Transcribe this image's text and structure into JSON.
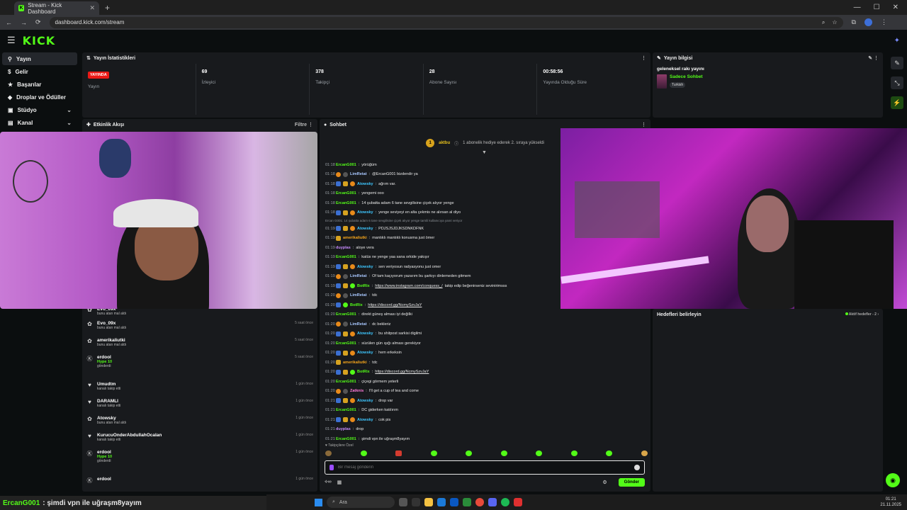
{
  "browser": {
    "tab_title": "Stream - Kick Dashboard",
    "url": "dashboard.kick.com/stream"
  },
  "header": {
    "logo": "KICK"
  },
  "sidebar": {
    "items": [
      {
        "label": "Yayın"
      },
      {
        "label": "Gelir"
      },
      {
        "label": "Başarılar"
      },
      {
        "label": "Droplar ve Ödüller"
      },
      {
        "label": "Stüdyo"
      },
      {
        "label": "Kanal"
      }
    ]
  },
  "stats": {
    "title": "Yayın İstatistikleri",
    "live_badge": "YAYINDA",
    "cells": [
      {
        "value": "",
        "label": "Yayın"
      },
      {
        "value": "69",
        "label": "İzleyici"
      },
      {
        "value": "378",
        "label": "Takipçi"
      },
      {
        "value": "28",
        "label": "Abone Sayısı"
      },
      {
        "value": "00:58:56",
        "label": "Yayında Olduğu Süre"
      }
    ]
  },
  "info": {
    "title": "Yayın bilgisi",
    "stream_title": "geleneksel rakı yayını",
    "category": "Sadece Sohbet",
    "language": "Turkish"
  },
  "activity": {
    "title": "Etkinlik Akışı",
    "filter": "Filtre",
    "items": [
      {
        "name": "Evo_09x",
        "sub": "bunu atan mal aldı",
        "time": "",
        "hype": ""
      },
      {
        "name": "Evo_09x",
        "sub": "bunu atan mal aldı",
        "time": "5 saat önce",
        "hype": ""
      },
      {
        "name": "amerikaliutki",
        "sub": "bunu atan mal aldı",
        "time": "5 saat önce",
        "hype": ""
      },
      {
        "name": "erdool",
        "sub": "gönderdi",
        "time": "5 saat önce",
        "hype": "Hype 10"
      },
      {
        "name": "Umudtm",
        "sub": "kanalı takip etti",
        "time": "1 gün önce",
        "hype": ""
      },
      {
        "name": "DARAMLI",
        "sub": "kanalı takip etti",
        "time": "1 gün önce",
        "hype": ""
      },
      {
        "name": "Atowsky",
        "sub": "bunu atan mal aldı",
        "time": "1 gün önce",
        "hype": ""
      },
      {
        "name": "KurucuOnderAbdullahOcalan",
        "sub": "kanalı takip etti",
        "time": "1 gün önce",
        "hype": ""
      },
      {
        "name": "erdool",
        "sub": "gönderdi",
        "time": "1 gün önce",
        "hype": "Hype 10"
      },
      {
        "name": "erdool",
        "sub": "",
        "time": "1 gün önce",
        "hype": ""
      }
    ]
  },
  "chat": {
    "title": "Sohbet",
    "pinned_user": "aktbu",
    "pinned_text": "1 abonelik hediye ederek 2. sıraya yükseldi",
    "follower_note": "Takipçilere Özel",
    "input_placeholder": "Bir mesaj gönderin",
    "send_label": "Gönder",
    "messages": [
      {
        "time": "01:18",
        "user": "ErcanG001",
        "color": "green",
        "text": "yörüğüm",
        "badges": []
      },
      {
        "time": "01:18",
        "user": "LimRetat",
        "color": "blue",
        "text": "@ErcanG001 bizdendir ya",
        "badges": [
          "or",
          "gr"
        ]
      },
      {
        "time": "01:18",
        "user": "Atowsky",
        "color": "cyan",
        "text": "ağrım var.",
        "badges": [
          "bl",
          "gd",
          "or"
        ]
      },
      {
        "time": "01:18",
        "user": "ErcanG001",
        "color": "green",
        "text": "yengemi ooo",
        "badges": []
      },
      {
        "time": "01:18",
        "user": "ErcanG001",
        "color": "green",
        "text": "14 şubatta adam 6 tane sevgilisine çiçek alıyor yenge",
        "badges": []
      },
      {
        "time": "01:18",
        "user": "Atowsky",
        "color": "cyan",
        "text": "yenge seviyeyi en alta çekmis ne alırsan al diyo",
        "badges": [
          "bl",
          "gd",
          "or"
        ]
      },
      {
        "reply": "Ercan G001: 14 şubatta adam 6 tane sevgilisine çiçek alıyor yenge tarnili kullanıcıya yanıt veriyor"
      },
      {
        "time": "01:19",
        "user": "Atowsky",
        "color": "cyan",
        "text": "PDJSJSJDJKSDNKDFNK",
        "badges": [
          "bl",
          "gd",
          "or"
        ]
      },
      {
        "time": "01:19",
        "user": "amerikaliutki",
        "color": "orange",
        "text": "mantıklı mantıklı konusma just ömer",
        "badges": [
          "gd"
        ]
      },
      {
        "time": "01:19",
        "user": "duyplas",
        "color": "purple",
        "text": "aloye vera",
        "badges": []
      },
      {
        "time": "01:19",
        "user": "ErcanG001",
        "color": "green",
        "text": "katüs ne yenge yaa sana orkide yakışır",
        "badges": []
      },
      {
        "time": "01:19",
        "user": "Atowsky",
        "color": "cyan",
        "text": "sen veriyosun radyasyonu just omer",
        "badges": [
          "bl",
          "gd",
          "or"
        ]
      },
      {
        "time": "01:19",
        "user": "LimRetat",
        "color": "blue",
        "text": "Of tam kaçıyorum yazarım bu şarkıyı dinlemeden gitmem",
        "badges": [
          "or",
          "gr"
        ]
      },
      {
        "time": "01:19",
        "user": "BotRix",
        "color": "green",
        "text": "",
        "link": "https://www.instagram.com/conquess_/",
        "text2": "takip edip beğenirseniz sevinirimsss",
        "badges": [
          "bl",
          "gd",
          "gn"
        ]
      },
      {
        "time": "01:20",
        "user": "LimRetat",
        "color": "blue",
        "text": "tdc",
        "badges": [
          "or",
          "gr"
        ]
      },
      {
        "time": "01:20",
        "user": "BotRix",
        "color": "green",
        "text": "",
        "link": "https://discord.gg/NcmySzvJaY",
        "text2": "",
        "badges": [
          "bl",
          "gn"
        ]
      },
      {
        "time": "01:20",
        "user": "ErcanG001",
        "color": "green",
        "text": "direkt güneş alması iyi değilki",
        "badges": []
      },
      {
        "time": "01:20",
        "user": "LimRetat",
        "color": "blue",
        "text": "dc bekleriz",
        "badges": [
          "or",
          "gr"
        ]
      },
      {
        "time": "01:20",
        "user": "Atowsky",
        "color": "cyan",
        "text": "bu shitpost sarkisi digilmi",
        "badges": [
          "bl",
          "gd",
          "or"
        ]
      },
      {
        "time": "01:20",
        "user": "ErcanG001",
        "color": "green",
        "text": "süzülen gün ışığı alması gerekiyor",
        "badges": []
      },
      {
        "time": "01:20",
        "user": "Atowsky",
        "color": "cyan",
        "text": "hem erkeksin",
        "badges": [
          "bl",
          "gd",
          "or"
        ]
      },
      {
        "time": "01:20",
        "user": "amerikaliutki",
        "color": "orange",
        "text": "tdc",
        "badges": [
          "gd"
        ]
      },
      {
        "time": "01:20",
        "user": "BotRix",
        "color": "green",
        "text": "",
        "link": "https://discord.gg/NcmySzvJaY",
        "text2": "",
        "badges": [
          "bl",
          "gd",
          "gn"
        ]
      },
      {
        "time": "01:20",
        "user": "ErcanG001",
        "color": "green",
        "text": "çiçegi görmem yeterli",
        "badges": []
      },
      {
        "time": "01:20",
        "user": "Zatknis",
        "color": "pink",
        "text": "I'll get a cup of tea and come",
        "badges": [
          "or",
          "gr"
        ]
      },
      {
        "time": "01:21",
        "user": "Atowsky",
        "color": "cyan",
        "text": "drop var",
        "badges": [
          "bl",
          "gd",
          "or"
        ]
      },
      {
        "time": "01:21",
        "user": "ErcanG001",
        "color": "green",
        "text": "DC giderken katılırım",
        "badges": []
      },
      {
        "time": "01:21",
        "user": "Atowsky",
        "color": "cyan",
        "text": "cok pis",
        "badges": [
          "bl",
          "gd",
          "or"
        ]
      },
      {
        "time": "01:21",
        "user": "duyplas",
        "color": "purple",
        "text": "drop",
        "badges": []
      },
      {
        "time": "01:21",
        "user": "ErcanG001",
        "color": "green",
        "text": "şimdi vpn ile uğraşm8yayım",
        "badges": []
      }
    ]
  },
  "goals": {
    "title": "Hedefleri belirleyin",
    "active": "Aktif hedefler - 2"
  },
  "ticker": {
    "user": "ErcanG001",
    "text": ": şimdi vpn ile uğraşm8yayım"
  },
  "taskbar": {
    "search": "Ara",
    "time": "01:21",
    "date": "21.11.2025"
  },
  "colors": {
    "accent": "#53fc18",
    "live": "#e91916",
    "panel": "#181a1d",
    "bg": "#0b0e0f"
  }
}
